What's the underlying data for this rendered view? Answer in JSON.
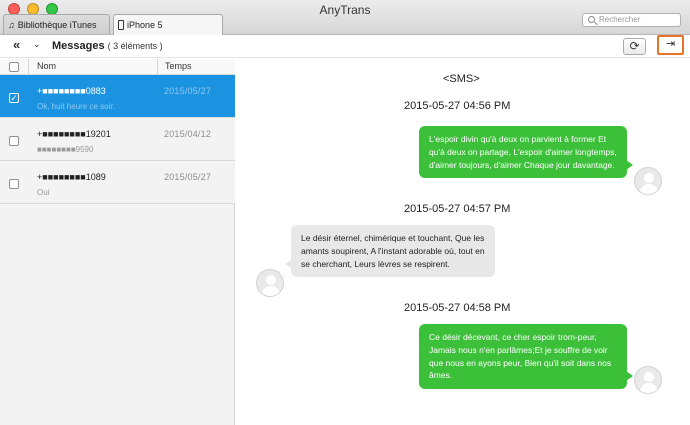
{
  "window": {
    "title": "AnyTrans",
    "tabs": [
      {
        "label": "Bibliothèque iTunes",
        "icon": "music-note-icon"
      },
      {
        "label": "iPhone 5",
        "icon": "iphone-icon"
      }
    ],
    "search_placeholder": "Rechercher"
  },
  "toolbar": {
    "back_icon": "«",
    "dropdown_icon": "⌄",
    "title": "Messages",
    "count": "( 3 éléments )",
    "refresh_icon": "⟳",
    "export_icon": "⇥"
  },
  "list": {
    "headers": {
      "name": "Nom",
      "time": "Temps"
    },
    "rows": [
      {
        "name": "+■■■■■■■■0883",
        "preview": "Ok, huit heure ce soir.",
        "time": "2015/05/27",
        "selected": true
      },
      {
        "name": "+■■■■■■■■19201",
        "preview": "■■■■■■■■9590",
        "time": "2015/04/12",
        "selected": false
      },
      {
        "name": "+■■■■■■■■1089",
        "preview": "Oui",
        "time": "2015/05/27",
        "selected": false
      }
    ]
  },
  "conversation": {
    "label": "<SMS>",
    "messages": [
      {
        "timestamp": "2015-05-27 04:56 PM",
        "direction": "out",
        "text": "L'espoir divin qu'à deux on parvient à former Et qu'à deux on partage, L'espoir d'aimer longtemps, d'aimer toujours, d'aimer Chaque jour davantage."
      },
      {
        "timestamp": "2015-05-27 04:57 PM",
        "direction": "in",
        "text": "Le désir éternel, chimérique et touchant, Que les amants soupirent, A l'instant adorable où, tout en se cherchant, Leurs lèvres se respirent."
      },
      {
        "timestamp": "2015-05-27 04:58 PM",
        "direction": "out",
        "text": "Ce désir décevant, ce cher espoir trom-peur, Jamais nous n'en parlâmes;Et je souffre de voir que nous en ayons peur, Bien qu'il soit dans nos âmes."
      }
    ]
  },
  "colors": {
    "selection": "#1b93e1",
    "sent_bubble": "#3cc039",
    "received_bubble": "#e8e8e8",
    "export_highlight": "#e8722a"
  }
}
